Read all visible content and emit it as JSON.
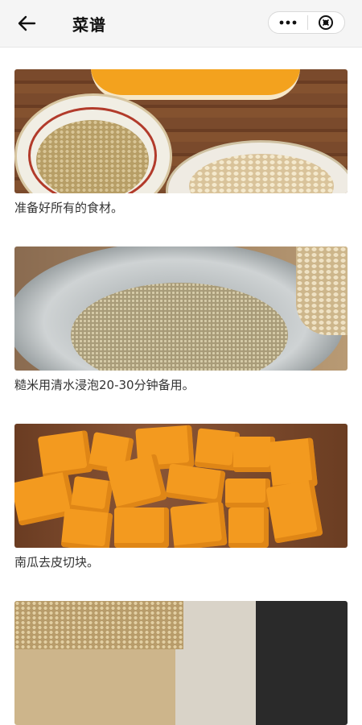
{
  "header": {
    "title": "菜谱"
  },
  "steps": [
    {
      "caption": "准备好所有的食材。"
    },
    {
      "caption": "糙米用清水浸泡20-30分钟备用。"
    },
    {
      "caption": "南瓜去皮切块。"
    },
    {
      "caption": ""
    }
  ]
}
